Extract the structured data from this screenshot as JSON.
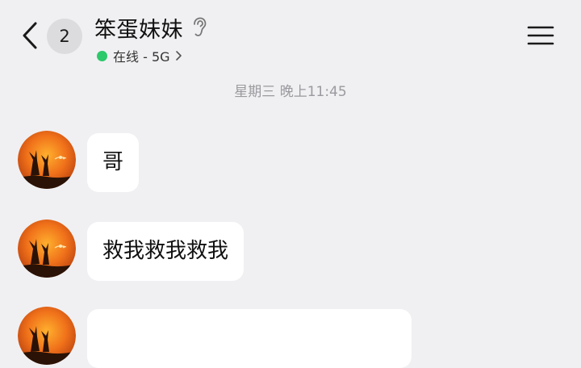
{
  "header": {
    "unread_count": "2",
    "contact_name": "笨蛋妹妹",
    "status_text": "在线 - 5G"
  },
  "chat": {
    "timestamp": "星期三 晚上11:45",
    "messages": [
      {
        "text": "哥"
      },
      {
        "text": "救我救我救我"
      },
      {
        "text": ""
      }
    ]
  },
  "colors": {
    "background": "#f0f0f2",
    "bubble": "#ffffff",
    "online_dot": "#2dc96a",
    "timestamp_text": "#9a9a9f"
  },
  "icons": {
    "back": "chevron-left-icon",
    "hearing": "ear-icon",
    "status_more": "chevron-right-icon",
    "menu": "hamburger-menu-icon"
  }
}
